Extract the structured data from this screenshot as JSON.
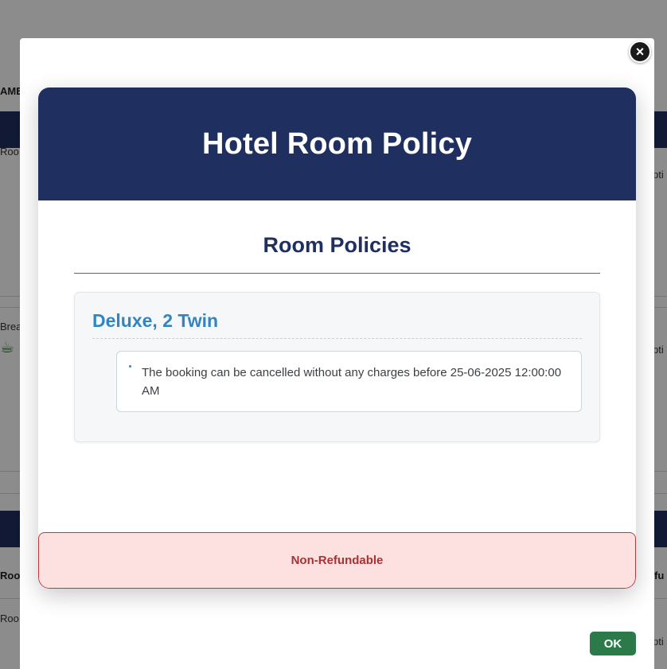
{
  "background": {
    "header_fragment": "AME",
    "row_texts": [
      "Roo",
      "Brea",
      "Roo",
      "Roo"
    ],
    "right_texts": [
      "pti",
      "pti",
      "fu",
      "pti"
    ]
  },
  "modal": {
    "close_icon": "×",
    "policy": {
      "title": "Hotel Room Policy",
      "section_title": "Room Policies",
      "room": {
        "name": "Deluxe, 2 Twin",
        "rules": [
          "The booking can be cancelled without any charges before 25-06-2025 12:00:00 AM"
        ]
      },
      "refund_status": "Non-Refundable"
    },
    "ok_label": "OK"
  },
  "colors": {
    "header_navy": "#1f2f5f",
    "room_blue": "#2f86c3",
    "refund_bg": "#fde1e1",
    "refund_text": "#a83232",
    "ok_green": "#2c7a4a"
  },
  "icons": {
    "close": "close-icon",
    "bullet": "bullet-icon",
    "breakfast": "coffee-cup-icon"
  }
}
